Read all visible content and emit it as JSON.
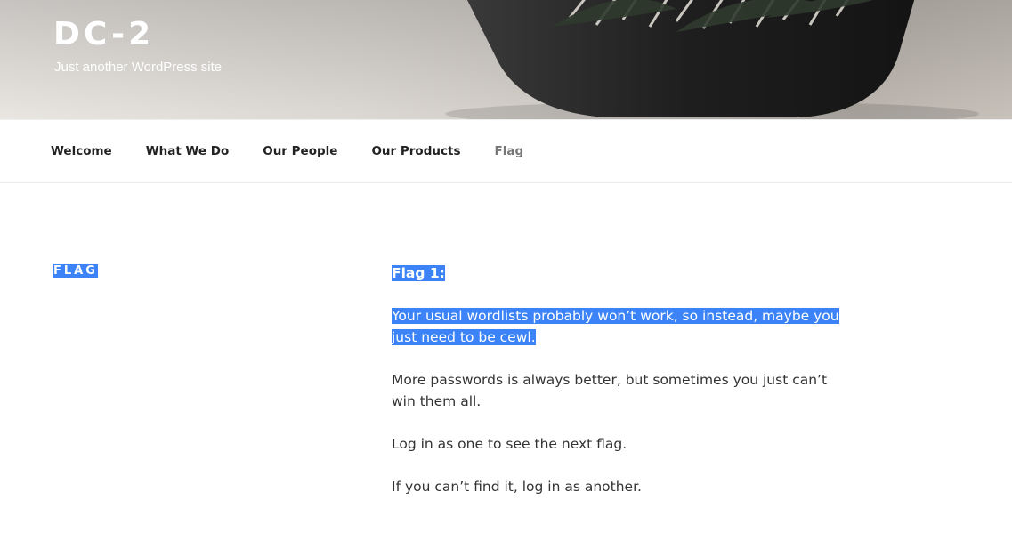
{
  "site": {
    "title": "DC-2",
    "description": "Just another WordPress site"
  },
  "nav": {
    "items": [
      {
        "label": "Welcome",
        "current": false
      },
      {
        "label": "What We Do",
        "current": false
      },
      {
        "label": "Our People",
        "current": false
      },
      {
        "label": "Our Products",
        "current": false
      },
      {
        "label": "Flag",
        "current": true
      }
    ]
  },
  "page": {
    "title": "FLAG",
    "heading": "Flag 1:",
    "paragraphs": [
      "Your usual wordlists probably won’t work, so instead, maybe you just need to be cewl.",
      "More passwords is always better, but sometimes you just can’t win them all.",
      "Log in as one to see the next flag.",
      "If you can’t find it, log in as another."
    ]
  },
  "colors": {
    "selection": "#3b83f7",
    "nav_current": "#767676",
    "text": "#333333"
  }
}
